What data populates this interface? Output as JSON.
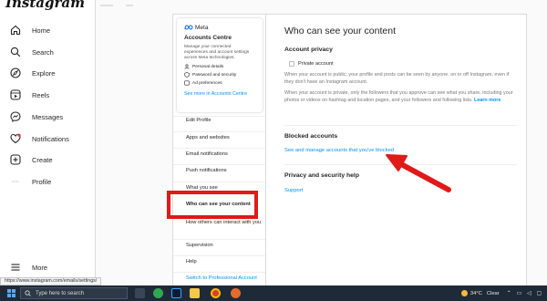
{
  "app": {
    "logo_text": "Instagram"
  },
  "leftnav": {
    "home": "Home",
    "search": "Search",
    "explore": "Explore",
    "reels": "Reels",
    "messages": "Messages",
    "notifications": "Notifications",
    "create": "Create",
    "profile": "Profile",
    "more": "More"
  },
  "accounts_centre": {
    "meta_label": "Meta",
    "title": "Accounts Centre",
    "description": "Manage your connected experiences and account settings across Meta technologies.",
    "items": [
      "Personal details",
      "Password and security",
      "Ad preferences"
    ],
    "see_more": "See more in Accounts Centre"
  },
  "settings_nav": {
    "edit_profile": "Edit Profile",
    "apps": "Apps and websites",
    "email": "Email notifications",
    "push": "Push notifications",
    "what_you_see": "What you see",
    "who_can_see": "Who can see your content",
    "how_others": "How others can interact with you",
    "supervision": "Supervision",
    "help": "Help",
    "switch_pro": "Switch to Professional Account"
  },
  "content": {
    "title": "Who can see your content",
    "privacy_title": "Account privacy",
    "private_label": "Private account",
    "private_checked": false,
    "privacy_desc_1": "When your account is public, your profile and posts can be seen by anyone, on or off Instagram, even if they don't have an Instagram account.",
    "privacy_desc_2": "When your account is private, only the followers that you approve can see what you share, including your photos or videos on hashtag and location pages, and your followers and following lists.",
    "learn_more": "Learn more",
    "blocked_title": "Blocked accounts",
    "blocked_link": "See and manage accounts that you've blocked",
    "psh_title": "Privacy and security help",
    "support": "Support"
  },
  "status_url": "https://www.instagram.com/emails/settings/",
  "taskbar": {
    "search_placeholder": "Type here to search",
    "temperature": "34°C",
    "weather": "Clear"
  },
  "colors": {
    "link_blue": "#0095f6",
    "highlight_red": "#e01919",
    "arrow_red": "#e01919",
    "taskbar_bg": "#1f2a38"
  }
}
